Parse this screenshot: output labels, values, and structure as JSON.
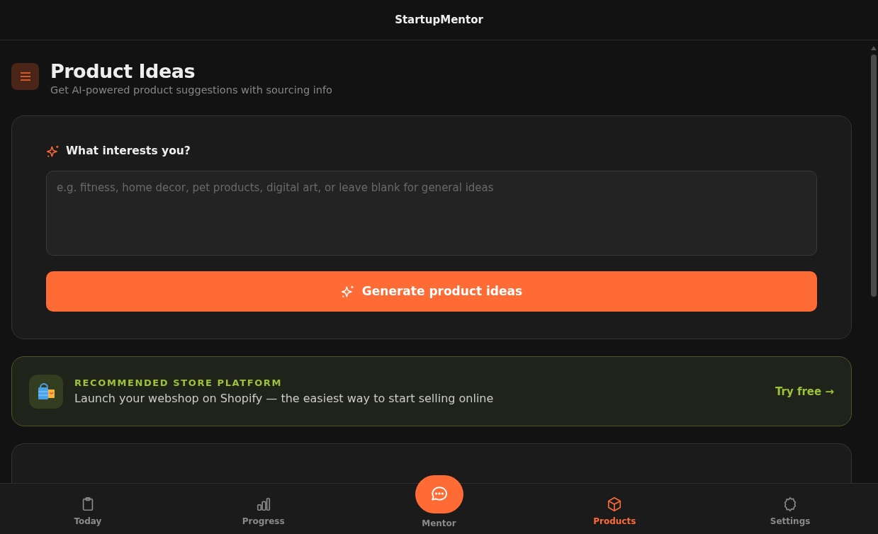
{
  "app_title": "StartupMentor",
  "page": {
    "title": "Product Ideas",
    "subtitle": "Get AI-powered product suggestions with sourcing info"
  },
  "form": {
    "label": "What interests you?",
    "placeholder": "e.g. fitness, home decor, pet products, digital art, or leave blank for general ideas",
    "button": "Generate product ideas"
  },
  "promo": {
    "eyebrow": "RECOMMENDED STORE PLATFORM",
    "text": "Launch your webshop on Shopify — the easiest way to start selling online",
    "link": "Try free →"
  },
  "nav": [
    {
      "label": "Today",
      "kind": "tab",
      "selected": false
    },
    {
      "label": "Progress",
      "kind": "tab",
      "selected": false
    },
    {
      "label": "Mentor",
      "kind": "fab",
      "selected": false
    },
    {
      "label": "Products",
      "kind": "tab",
      "selected": true
    },
    {
      "label": "Settings",
      "kind": "tab",
      "selected": false
    }
  ]
}
